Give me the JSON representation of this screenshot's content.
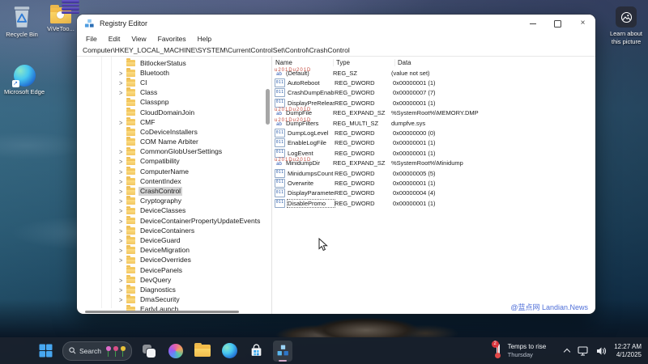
{
  "desktop": {
    "icons": {
      "recycle_bin": "Recycle Bin",
      "vivetool_folder": "ViVeToo...",
      "edge_shortcut": "Microsoft Edge"
    },
    "learn_about": {
      "line1": "Learn about",
      "line2": "this picture"
    }
  },
  "window": {
    "title": "Registry Editor",
    "menu": [
      "File",
      "Edit",
      "View",
      "Favorites",
      "Help"
    ],
    "address": "Computer\\HKEY_LOCAL_MACHINE\\SYSTEM\\CurrentControlSet\\Control\\CrashControl",
    "tree": {
      "items": [
        {
          "label": "BitlockerStatus",
          "arrow": false
        },
        {
          "label": "Bluetooth",
          "arrow": true
        },
        {
          "label": "CI",
          "arrow": true
        },
        {
          "label": "Class",
          "arrow": true
        },
        {
          "label": "Classpnp",
          "arrow": false
        },
        {
          "label": "CloudDomainJoin",
          "arrow": false
        },
        {
          "label": "CMF",
          "arrow": true
        },
        {
          "label": "CoDeviceInstallers",
          "arrow": false
        },
        {
          "label": "COM Name Arbiter",
          "arrow": false
        },
        {
          "label": "CommonGlobUserSettings",
          "arrow": true
        },
        {
          "label": "Compatibility",
          "arrow": true
        },
        {
          "label": "ComputerName",
          "arrow": true
        },
        {
          "label": "ContentIndex",
          "arrow": true
        },
        {
          "label": "CrashControl",
          "arrow": true,
          "selected": true
        },
        {
          "label": "Cryptography",
          "arrow": true
        },
        {
          "label": "DeviceClasses",
          "arrow": true
        },
        {
          "label": "DeviceContainerPropertyUpdateEvents",
          "arrow": true
        },
        {
          "label": "DeviceContainers",
          "arrow": true
        },
        {
          "label": "DeviceGuard",
          "arrow": true
        },
        {
          "label": "DeviceMigration",
          "arrow": true
        },
        {
          "label": "DeviceOverrides",
          "arrow": true
        },
        {
          "label": "DevicePanels",
          "arrow": false
        },
        {
          "label": "DevQuery",
          "arrow": true
        },
        {
          "label": "Diagnostics",
          "arrow": true
        },
        {
          "label": "DmaSecurity",
          "arrow": true
        },
        {
          "label": "EarlyLaunch",
          "arrow": false
        }
      ]
    },
    "values": {
      "columns": [
        "Name",
        "Type",
        "Data"
      ],
      "icon_glyphs": {
        "sz": "ab",
        "dword": "011"
      },
      "rows": [
        {
          "icon": "sz",
          "name": "(Default)",
          "type": "REG_SZ",
          "data": "(value not set)"
        },
        {
          "icon": "dword",
          "name": "AutoReboot",
          "type": "REG_DWORD",
          "data": "0x00000001 (1)"
        },
        {
          "icon": "dword",
          "name": "CrashDumpEnabl...",
          "type": "REG_DWORD",
          "data": "0x00000007 (7)"
        },
        {
          "icon": "dword",
          "name": "DisplayPreReleas...",
          "type": "REG_DWORD",
          "data": "0x00000001 (1)"
        },
        {
          "icon": "sz",
          "name": "DumpFile",
          "type": "REG_EXPAND_SZ",
          "data": "%SystemRoot%\\MEMORY.DMP"
        },
        {
          "icon": "sz",
          "name": "DumpFilters",
          "type": "REG_MULTI_SZ",
          "data": "dumpfve.sys"
        },
        {
          "icon": "dword",
          "name": "DumpLogLevel",
          "type": "REG_DWORD",
          "data": "0x00000000 (0)"
        },
        {
          "icon": "dword",
          "name": "EnableLogFile",
          "type": "REG_DWORD",
          "data": "0x00000001 (1)"
        },
        {
          "icon": "dword",
          "name": "LogEvent",
          "type": "REG_DWORD",
          "data": "0x00000001 (1)"
        },
        {
          "icon": "sz",
          "name": "MinidumpDir",
          "type": "REG_EXPAND_SZ",
          "data": "%SystemRoot%\\Minidump"
        },
        {
          "icon": "dword",
          "name": "MinidumpsCount",
          "type": "REG_DWORD",
          "data": "0x00000005 (5)"
        },
        {
          "icon": "dword",
          "name": "Overwrite",
          "type": "REG_DWORD",
          "data": "0x00000001 (1)"
        },
        {
          "icon": "dword",
          "name": "DisplayParameters",
          "type": "REG_DWORD",
          "data": "0x00000004 (4)"
        },
        {
          "icon": "dword",
          "name": "DisablePromo",
          "type": "REG_DWORD",
          "data": "0x00000001 (1)",
          "focused": true
        }
      ]
    },
    "watermark": "@蓝点网 Landian.News"
  },
  "taskbar": {
    "search_label": "Search",
    "weather": {
      "badge": "2",
      "line1": "Temps to rise",
      "line2": "Thursday"
    },
    "clock": {
      "time": "12:27 AM",
      "date": "4/1/2025"
    }
  },
  "colors": {
    "accent_blue": "#2d6fb5",
    "watermark_blue": "#4f6fd8",
    "selection_gray": "#d4d4d4",
    "taskbar_dark": "#191f2a"
  }
}
